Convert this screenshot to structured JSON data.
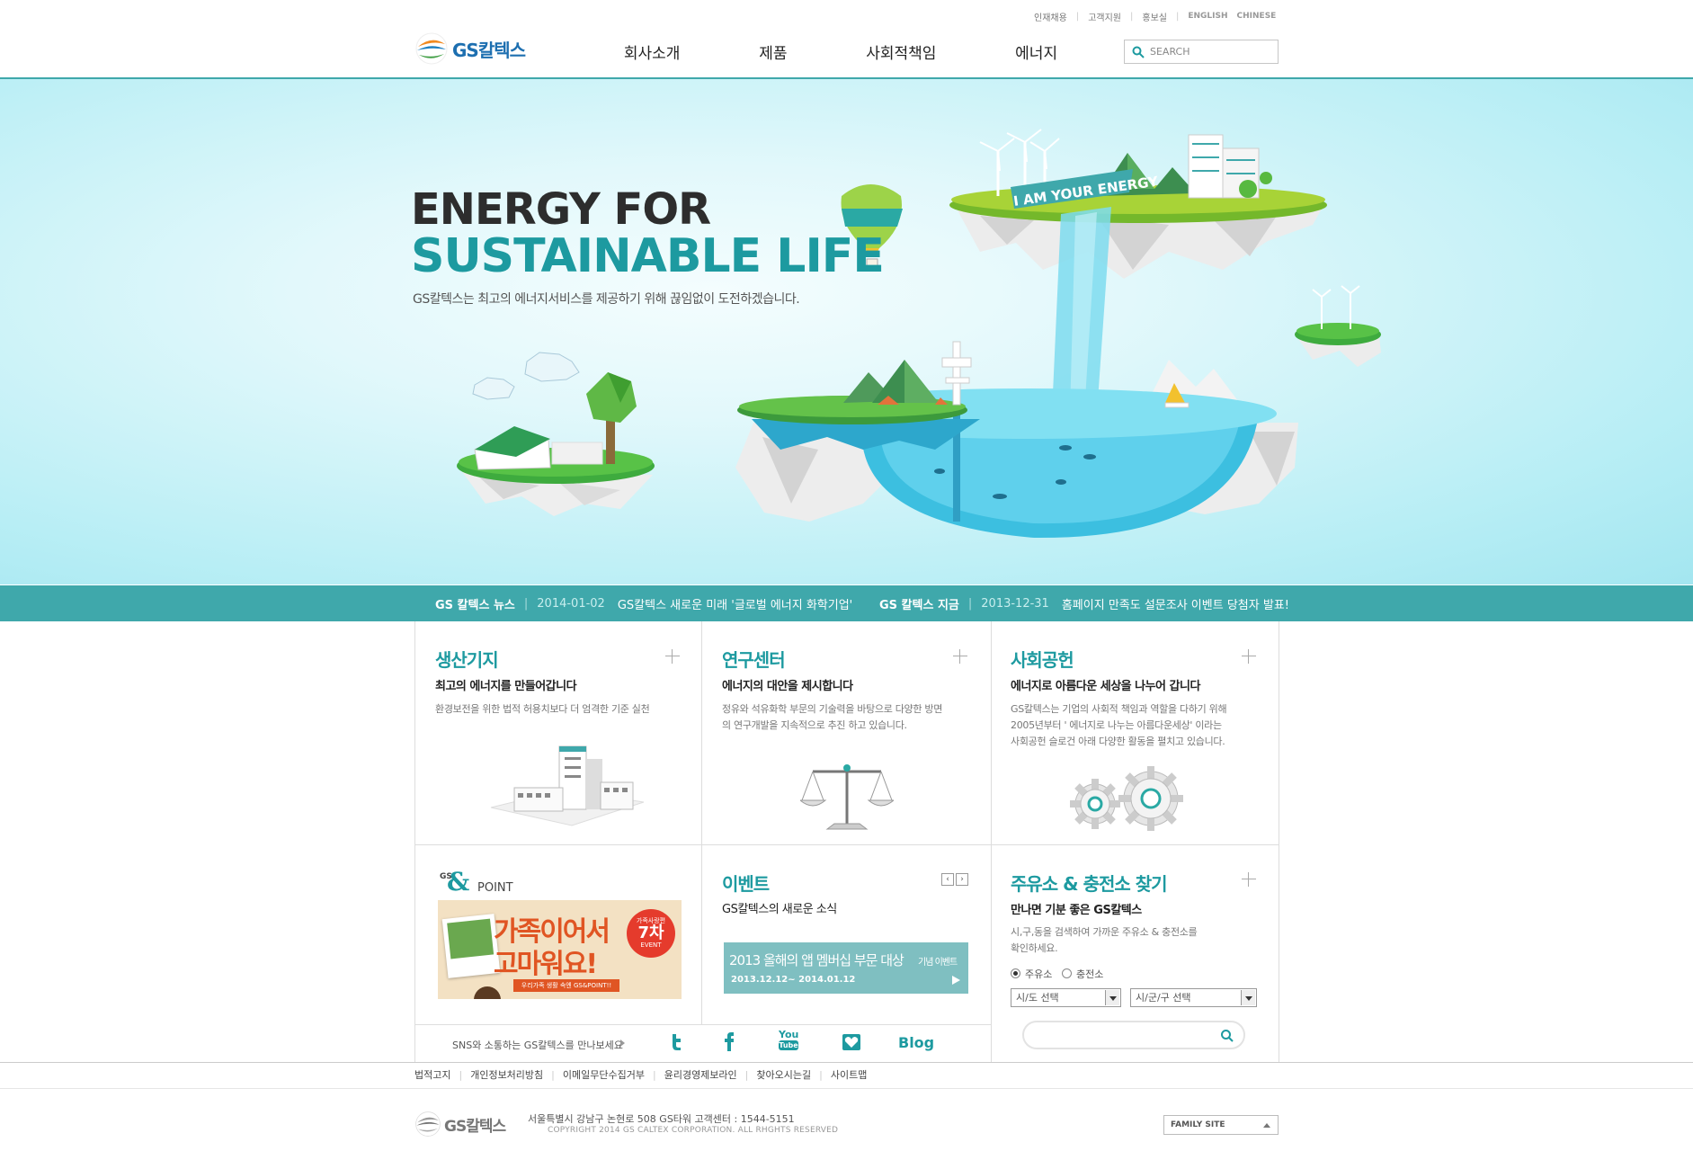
{
  "header": {
    "logo_text": "GS칼텍스",
    "util_links": [
      "인재채용",
      "고객지원",
      "홍보실"
    ],
    "lang_links": [
      "ENGLISH",
      "CHINESE"
    ],
    "nav": [
      "회사소개",
      "제품",
      "사회적책임",
      "에너지"
    ],
    "search_placeholder": "SEARCH"
  },
  "hero": {
    "title_line1": "ENERGY FOR",
    "title_line2": "SUSTAINABLE LIFE",
    "description": "GS칼텍스는 최고의 에너지서비스를 제공하기 위해 끊임없이 도전하겠습니다.",
    "banner_text": "I AM YOUR ENERGY"
  },
  "news": [
    {
      "category": "GS 칼텍스 뉴스",
      "date": "2014-01-02",
      "headline": "GS칼텍스 새로운 미래 '글로벌 에너지 화학기업'"
    },
    {
      "category": "GS 칼텍스 지금",
      "date": "2013-12-31",
      "headline": "홈페이지 만족도 설문조사 이벤트 당첨자 발표!"
    }
  ],
  "cards": {
    "production": {
      "title": "생산기지",
      "subtitle": "최고의 에너지를 만들어갑니다",
      "desc": "환경보전을 위한 법적 허용치보다 더 엄격한 기준 실천"
    },
    "research": {
      "title": "연구센터",
      "subtitle": "에너지의 대안을 제시합니다",
      "desc_lines": [
        "정유와 석유화학 부문의 기술력을 바탕으로 다양한 방면",
        "의 연구개발을 지속적으로 추진 하고 있습니다."
      ]
    },
    "social": {
      "title": "사회공헌",
      "subtitle": "에너지로 아름다운 세상을 나누어 갑니다",
      "desc_lines": [
        "GS칼텍스는 기업의 사회적 책임과 역할을 다하기 위해",
        "2005년부터 ' 에너지로 나누는 아름다운세상' 이라는",
        "사회공헌 슬로건 아래 다양한 활동을 펼치고 있습니다."
      ]
    },
    "point": {
      "logo_gs": "GS",
      "logo_amp": "&",
      "logo_point": "POINT",
      "banner_line1": "가족이어서",
      "banner_line2": "고마워요!",
      "badge_top": "가족사랑편",
      "badge_main": "7차",
      "badge_sub": "EVENT",
      "ribbon": "우리가족 생활 속엔 GS&POINT!!"
    },
    "event": {
      "title": "이벤트",
      "subtitle": "GS칼텍스의 새로운 소식",
      "banner_title": "2013 올해의 앱 멤버십 부문 대상",
      "banner_suffix": "기념 이벤트",
      "banner_period": "2013.12.12~ 2014.01.12"
    },
    "station": {
      "title": "주유소 & 충전소 찾기",
      "subtitle": "만나면 기분 좋은 GS칼텍스",
      "desc_lines": [
        "시,구,동을 검색하여 가까운 주유소 & 충전소를",
        "확인하세요."
      ],
      "radio_gas": "주유소",
      "radio_charge": "충전소",
      "select_city": "시/도 선택",
      "select_district": "시/군/구 선택"
    }
  },
  "sns": {
    "label": "SNS와 소통하는 GS칼텍스를 만나보세요",
    "youtube_top": "You",
    "youtube_bottom": "Tube",
    "blog": "Blog"
  },
  "footer": {
    "links": [
      "법적고지",
      "개인정보처리방침",
      "이메일무단수집거부",
      "윤리경영제보라인",
      "찾아오시는길",
      "사이트맵"
    ],
    "logo_text": "GS칼텍스",
    "address": "서울특별시 강남구 논현로 508 GS타워    고객센터 : 1544-5151",
    "copyright": "COPYRIGHT 2014 GS CALTEX CORPORATION. ALL RHGHTS RESERVED",
    "family_site": "FAMILY SITE"
  },
  "colors": {
    "brand_teal": "#1d9aa0",
    "news_bar": "#3fa8ab",
    "sky": "#b8eef5"
  }
}
